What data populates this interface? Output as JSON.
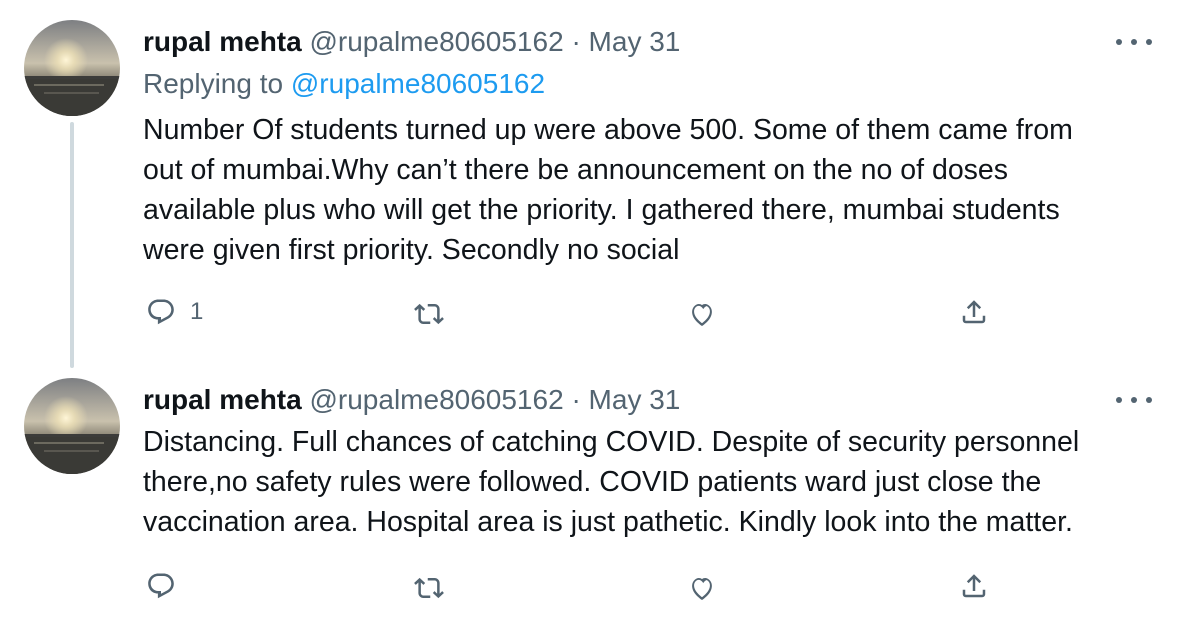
{
  "tweets": [
    {
      "author": {
        "name": "rupal mehta",
        "handle": "@rupalme80605162"
      },
      "separator": "·",
      "date": "May 31",
      "replying": {
        "prefix": "Replying to",
        "handle": "@rupalme80605162"
      },
      "lines": [
        "Number Of students turned up were above 500. Some of them came from",
        "out of mumbai.Why can’t there be announcement on the no of doses",
        "available plus who will get the priority. I gathered there,  mumbai students",
        "were given first priority. Secondly no social"
      ],
      "actions": {
        "reply_count": "1",
        "retweet_count": "",
        "like_count": ""
      }
    },
    {
      "author": {
        "name": "rupal mehta",
        "handle": "@rupalme80605162"
      },
      "separator": "·",
      "date": "May 31",
      "lines": [
        "Distancing. Full chances of catching COVID. Despite of security personnel",
        "there,no safety rules were followed. COVID patients ward just close the",
        "vaccination area. Hospital area is just pathetic. Kindly look into the matter."
      ],
      "actions": {
        "reply_count": "",
        "retweet_count": "",
        "like_count": ""
      }
    }
  ],
  "icons": [
    "avatar-image",
    "more-icon",
    "reply-icon",
    "retweet-icon",
    "like-icon",
    "share-icon"
  ],
  "colors": {
    "text": "#0f1419",
    "muted": "#536471",
    "link": "#1d9bf0",
    "thread_line": "#cfd9de",
    "background": "#ffffff"
  }
}
